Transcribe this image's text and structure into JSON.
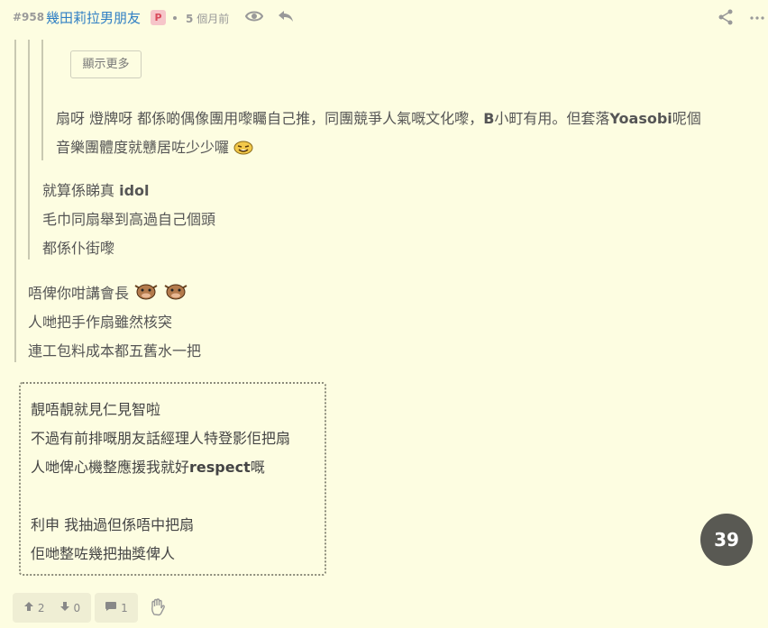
{
  "header": {
    "post_number": "#958",
    "username": "幾田莉拉男朋友",
    "badge": "P",
    "time_num": "5",
    "time_unit": "個月前"
  },
  "quote": {
    "show_more": "顯示更多",
    "deep_lines": [
      [
        "扇呀 燈牌呀 都係啲偶像團用嚟矚自己推，同團競爭人氣嘅文化嚟，",
        "B",
        "小町有用。但套落",
        "Yoasobi",
        "呢個"
      ],
      [
        "音樂團體度就戇居咗少少囉"
      ]
    ],
    "mid_lines": [
      [
        "就算係睇真 ",
        "idol"
      ],
      [
        "毛巾同扇舉到高過自己個頭"
      ],
      [
        "都係仆街嚟"
      ]
    ],
    "outer_lines": [
      "唔俾你咁講會長",
      "人哋把手作扇雖然核突",
      "連工包料成本都五舊水一把"
    ]
  },
  "reply": {
    "line1": "靚唔靚就見仁見智啦",
    "line2": "不過有前排嘅朋友話經理人特登影佢把扇",
    "line3a": "人哋俾心機整應援我就好",
    "line3b": "respect",
    "line3c": "嘅",
    "line4": "利申 我抽過但係唔中把扇",
    "line5": "佢哋整咗幾把抽獎俾人"
  },
  "page_badge": "39",
  "footer": {
    "upvotes": "2",
    "downvotes": "0",
    "comments": "1"
  },
  "colors": {
    "background": "#fdfde1",
    "username": "#2f7fc4",
    "badge_bg": "#f6c5c9",
    "page_badge_bg": "#595953"
  }
}
